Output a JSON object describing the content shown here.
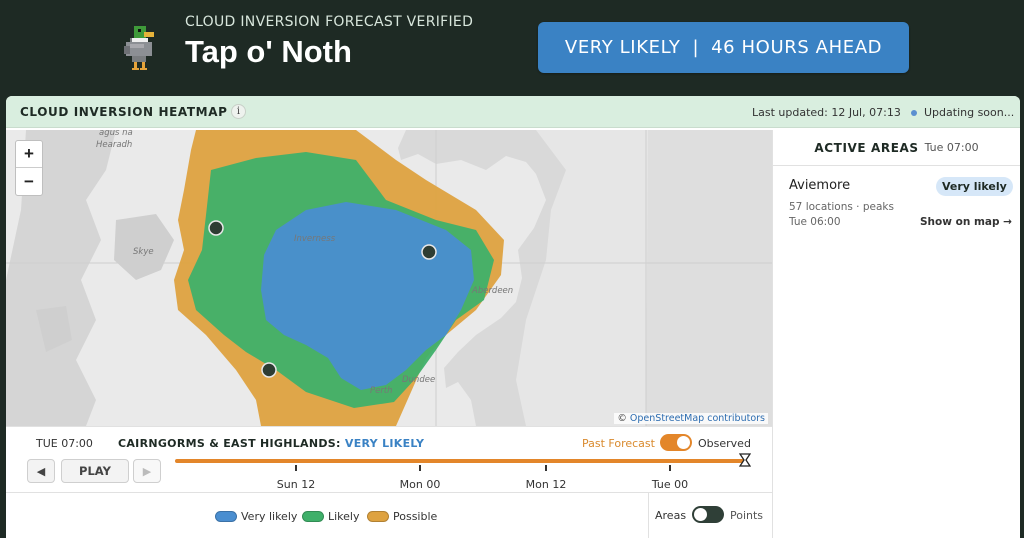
{
  "header": {
    "subtitle": "CLOUD INVERSION FORECAST VERIFIED",
    "title": "Tap o' Noth",
    "status_likelihood": "VERY LIKELY",
    "status_separator": "|",
    "status_ahead": "46 HOURS AHEAD",
    "logo_icon": "duck-icon"
  },
  "panel": {
    "title": "CLOUD INVERSION HEATMAP",
    "info_icon": "i",
    "last_updated": "Last updated: 12 Jul, 07:13",
    "updating": "Updating soon..."
  },
  "map": {
    "zoom_in": "+",
    "zoom_out": "−",
    "attribution_prefix": "©",
    "attribution_link": "OpenStreetMap contributors",
    "place_labels": [
      "agus na",
      "Hearadh",
      "Skye",
      "Inverness",
      "Aberdeen",
      "Dundee",
      "Perth"
    ],
    "colors": {
      "very_likely": "#4a8ed0",
      "likely": "#3fb06a",
      "possible": "#dea240",
      "marker": "#2e3d33"
    }
  },
  "sidebar": {
    "title": "ACTIVE AREAS",
    "time": "Tue 07:00",
    "area": {
      "name": "Aviemore",
      "badge": "Very likely",
      "meta": "57 locations · peaks",
      "time": "Tue 06:00",
      "show_link": "Show on map →"
    }
  },
  "timeline": {
    "current_time": "TUE 07:00",
    "region_prefix": "CAIRNGORMS & EAST HIGHLANDS:",
    "region_status": "VERY LIKELY",
    "past_forecast_label": "Past Forecast",
    "observed_label": "Observed",
    "prev_icon": "◀",
    "play_label": "PLAY",
    "next_icon": "▶",
    "tick_labels": [
      "Sun 12",
      "Mon 00",
      "Mon 12",
      "Tue 00"
    ],
    "accent": "#e3862a"
  },
  "legend": {
    "items": [
      {
        "label": "Very likely",
        "color": "#4a8ed0"
      },
      {
        "label": "Likely",
        "color": "#3fb06a"
      },
      {
        "label": "Possible",
        "color": "#dea240"
      }
    ],
    "areas_label": "Areas",
    "points_label": "Points"
  }
}
